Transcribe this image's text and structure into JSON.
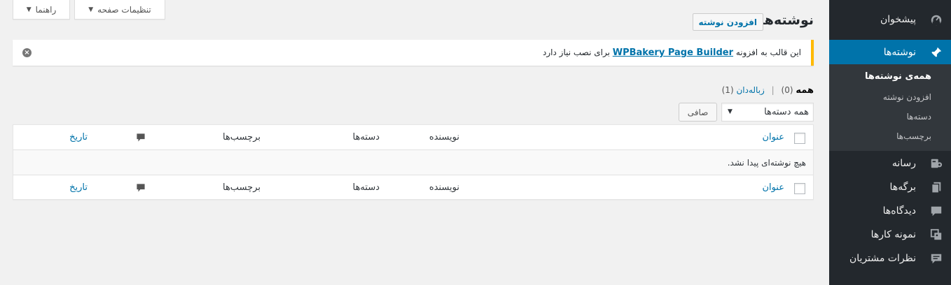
{
  "screen_meta": {
    "help_label": "راهنما",
    "screen_options_label": "تنظیمات صفحه"
  },
  "heading": {
    "title": "نوشته‌ها",
    "add_new": "افزودن نوشته"
  },
  "notice": {
    "prefix": "این قالب به افزونه",
    "plugin_link": "WPBakery Page Builder",
    "suffix": "برای نصب نیاز دارد"
  },
  "filters": {
    "all_label": "همه",
    "all_count": "(0)",
    "trash_label": "زباله‌دان",
    "trash_count": "(1)"
  },
  "bulk": {
    "category_select": "همه دسته‌ها",
    "filter_button": "صافی"
  },
  "table": {
    "columns": {
      "title": "عنوان",
      "author": "نویسنده",
      "categories": "دسته‌ها",
      "tags": "برچسب‌ها",
      "date": "تاریخ"
    },
    "empty_message": "هیچ نوشته‌ای پیدا نشد."
  },
  "sidebar": {
    "items": [
      {
        "label": "پیشخوان",
        "icon": "dashboard-icon"
      },
      {
        "label": "نوشته‌ها",
        "icon": "pin-icon"
      },
      {
        "label": "رسانه",
        "icon": "media-icon"
      },
      {
        "label": "برگه‌ها",
        "icon": "pages-icon"
      },
      {
        "label": "دیدگاه‌ها",
        "icon": "comment-icon"
      },
      {
        "label": "نمونه کارها",
        "icon": "portfolio-icon"
      },
      {
        "label": "نظرات مشتریان",
        "icon": "testimonial-icon"
      }
    ],
    "submenu": [
      {
        "label": "همه‌ی نوشته‌ها"
      },
      {
        "label": "افزودن نوشته"
      },
      {
        "label": "دسته‌ها"
      },
      {
        "label": "برچسب‌ها"
      }
    ]
  },
  "colors": {
    "sidebar_bg": "#23282d",
    "submenu_bg": "#32373c",
    "accent": "#0073aa",
    "notice_border": "#ffb900",
    "page_bg": "#f1f1f1"
  }
}
